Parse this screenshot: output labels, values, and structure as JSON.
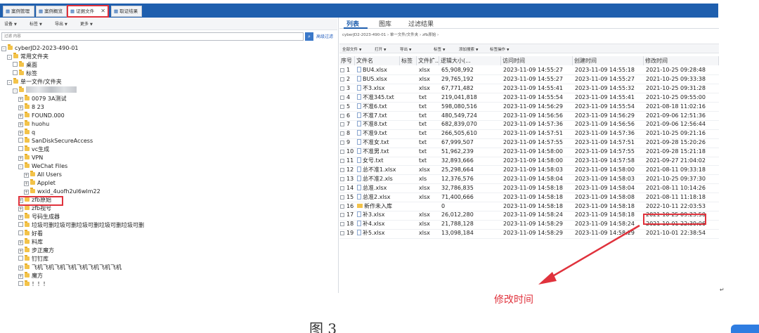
{
  "tabs": [
    {
      "label": "案例管理",
      "icon": "case-icon"
    },
    {
      "label": "案例概览",
      "icon": "overview-icon"
    },
    {
      "label": "证据文件",
      "icon": "evidence-icon",
      "active": true
    },
    {
      "label": "取证结果",
      "icon": "result-icon"
    }
  ],
  "left_toolbar": [
    "设备",
    "标签",
    "导出",
    "更多"
  ],
  "search": {
    "placeholder": "过滤 内容",
    "advanced": "高级过滤"
  },
  "tree": [
    {
      "label": "cyberJD2-2023-490-01",
      "level": 0,
      "exp": "-"
    },
    {
      "label": "常用文件夹",
      "level": 1,
      "exp": "-"
    },
    {
      "label": "桌面",
      "level": 2,
      "exp": ""
    },
    {
      "label": "标签",
      "level": 2,
      "exp": ""
    },
    {
      "label": "单一文件/文件夹",
      "level": 1,
      "exp": "-"
    },
    {
      "label": "",
      "level": 2,
      "exp": "-",
      "redacted": true
    },
    {
      "label": "0079 3A测试",
      "level": 3,
      "exp": "+"
    },
    {
      "label": "8 23",
      "level": 3,
      "exp": "+"
    },
    {
      "label": "FOUND.000",
      "level": 3,
      "exp": "+"
    },
    {
      "label": "huohu",
      "level": 3,
      "exp": "+"
    },
    {
      "label": "q",
      "level": 3,
      "exp": "+"
    },
    {
      "label": "SanDiskSecureAccess",
      "level": 3,
      "exp": ""
    },
    {
      "label": "vc生成",
      "level": 3,
      "exp": ""
    },
    {
      "label": "VPN",
      "level": 3,
      "exp": "+"
    },
    {
      "label": "WeChat Files",
      "level": 3,
      "exp": "-"
    },
    {
      "label": "All Users",
      "level": 4,
      "exp": "+"
    },
    {
      "label": "Applet",
      "level": 4,
      "exp": "+"
    },
    {
      "label": "wxid_4uofh2ul6wlm22",
      "level": 4,
      "exp": "+"
    },
    {
      "label": "zfb原始",
      "level": 3,
      "exp": "+",
      "highlight": true
    },
    {
      "label": "zfb视号",
      "level": 3,
      "exp": "+"
    },
    {
      "label": "号码生成器",
      "level": 3,
      "exp": "+"
    },
    {
      "label": "垃圾可删垃圾可删垃圾可删垃圾可删垃圾可删",
      "level": 3,
      "exp": ""
    },
    {
      "label": "好看",
      "level": 3,
      "exp": ""
    },
    {
      "label": "料库",
      "level": 3,
      "exp": "+"
    },
    {
      "label": "步正魔方",
      "level": 3,
      "exp": "+"
    },
    {
      "label": "钉钉库",
      "level": 3,
      "exp": ""
    },
    {
      "label": "飞机飞机飞机飞机飞机飞机飞机飞机",
      "level": 3,
      "exp": "+"
    },
    {
      "label": "魔方",
      "level": 3,
      "exp": "+"
    },
    {
      "label": "！！！",
      "level": 3,
      "exp": ""
    }
  ],
  "right_tabs": [
    "列表",
    "图库",
    "过滤结果"
  ],
  "breadcrumb": "cyberJD2-2023-490-01  ›  单一文件/文件夹  ›  zfb原始  ›",
  "right_toolbar": [
    "全部文件",
    "打开",
    "导出",
    "标签",
    "添加搜索",
    "标签操作"
  ],
  "columns": [
    "序号",
    "文件名",
    "标签",
    "文件扩...",
    "逻辑大小(...",
    "访问时间",
    "创建时间",
    "修改时间"
  ],
  "rows": [
    [
      "1",
      "BU4.xlsx",
      "",
      "xlsx",
      "65,908,992",
      "2023-11-09 14:55:27",
      "2023-11-09 14:55:18",
      "2021-10-25 09:28:48"
    ],
    [
      "2",
      "BU5.xlsx",
      "",
      "xlsx",
      "29,765,192",
      "2023-11-09 14:55:27",
      "2023-11-09 14:55:27",
      "2021-10-25 09:33:38"
    ],
    [
      "3",
      "不3.xlsx",
      "",
      "xlsx",
      "67,771,482",
      "2023-11-09 14:55:41",
      "2023-11-09 14:55:32",
      "2021-10-25 09:31:28"
    ],
    [
      "4",
      "不准345.txt",
      "",
      "txt",
      "219,041,818",
      "2023-11-09 14:55:54",
      "2023-11-09 14:55:41",
      "2021-10-25 09:55:00"
    ],
    [
      "5",
      "不准6.txt",
      "",
      "txt",
      "598,080,516",
      "2023-11-09 14:56:29",
      "2023-11-09 14:55:54",
      "2021-08-18 11:02:16"
    ],
    [
      "6",
      "不准7.txt",
      "",
      "txt",
      "480,549,724",
      "2023-11-09 14:56:56",
      "2023-11-09 14:56:29",
      "2021-09-06 12:51:36"
    ],
    [
      "7",
      "不准8.txt",
      "",
      "txt",
      "682,839,070",
      "2023-11-09 14:57:36",
      "2023-11-09 14:56:56",
      "2021-09-06 12:56:44"
    ],
    [
      "8",
      "不准9.txt",
      "",
      "txt",
      "266,505,610",
      "2023-11-09 14:57:51",
      "2023-11-09 14:57:36",
      "2021-10-25 09:21:16"
    ],
    [
      "9",
      "不准女.txt",
      "",
      "txt",
      "67,999,507",
      "2023-11-09 14:57:55",
      "2023-11-09 14:57:51",
      "2021-09-28 15:20:26"
    ],
    [
      "10",
      "不准男.txt",
      "",
      "txt",
      "51,962,239",
      "2023-11-09 14:58:00",
      "2023-11-09 14:57:55",
      "2021-09-28 15:21:18"
    ],
    [
      "11",
      "女号.txt",
      "",
      "txt",
      "32,893,666",
      "2023-11-09 14:58:00",
      "2023-11-09 14:57:58",
      "2021-09-27 21:04:02"
    ],
    [
      "12",
      "总不准1.xlsx",
      "",
      "xlsx",
      "25,298,664",
      "2023-11-09 14:58:03",
      "2023-11-09 14:58:00",
      "2021-08-11 09:33:18"
    ],
    [
      "13",
      "总不准2.xls",
      "",
      "xls",
      "12,376,576",
      "2023-11-09 14:58:04",
      "2023-11-09 14:58:03",
      "2021-10-25 09:37:30"
    ],
    [
      "14",
      "总准.xlsx",
      "",
      "xlsx",
      "32,786,835",
      "2023-11-09 14:58:18",
      "2023-11-09 14:58:04",
      "2021-08-11 10:14:26"
    ],
    [
      "15",
      "总准2.xlsx",
      "",
      "xlsx",
      "71,400,666",
      "2023-11-09 14:58:18",
      "2023-11-09 14:58:08",
      "2021-08-11 11:18:18"
    ],
    [
      "16",
      "新作未入库",
      "",
      "",
      "0",
      "2023-11-09 14:58:18",
      "2023-11-09 14:58:18",
      "2022-10-11 22:03:53"
    ],
    [
      "17",
      "补3.xlsx",
      "",
      "xlsx",
      "26,012,280",
      "2023-11-09 14:58:24",
      "2023-11-09 14:58:18",
      "2021-10-25 09:23:50"
    ],
    [
      "18",
      "补4.xlsx",
      "",
      "xlsx",
      "21,788,128",
      "2023-11-09 14:58:29",
      "2023-11-09 14:58:24",
      "2021-10-01 22:39:06"
    ],
    [
      "19",
      "补5.xlsx",
      "",
      "xlsx",
      "13,098,184",
      "2023-11-09 14:58:29",
      "2023-11-09 14:58:29",
      "2021-10-01 22:38:54"
    ]
  ],
  "annotation": "修改时间",
  "caption": "图 3",
  "colors": {
    "tabbar": "#1f5fae",
    "highlight": "#e0323c",
    "folder": "#f3c34a"
  }
}
